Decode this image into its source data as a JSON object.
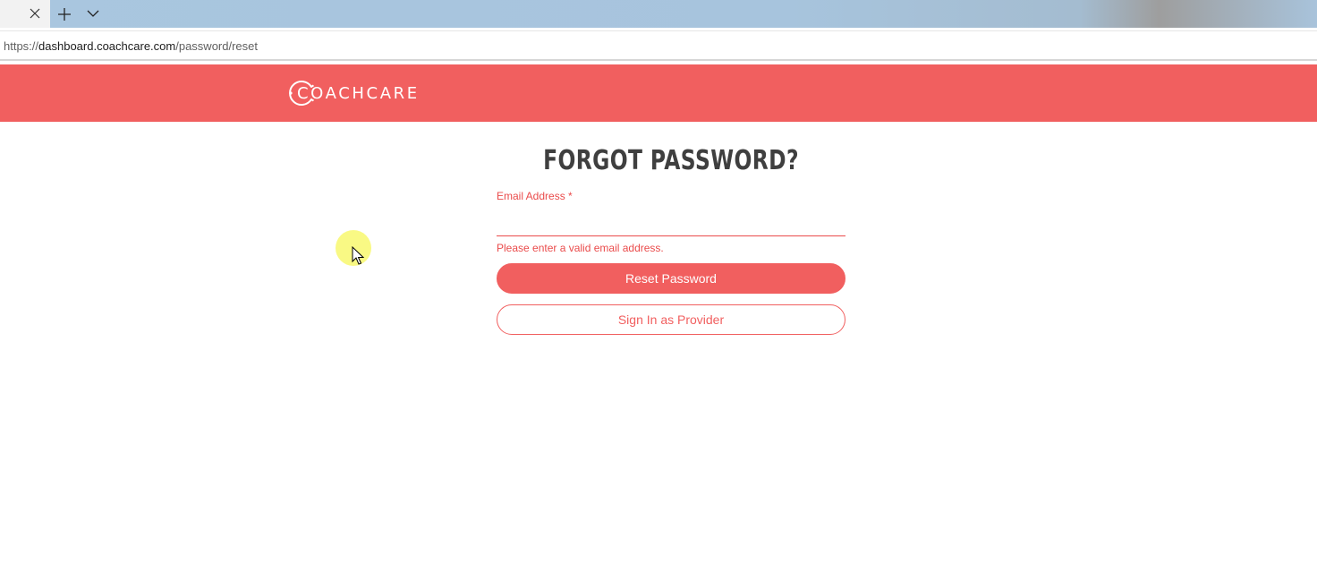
{
  "browser": {
    "url_scheme": "https://",
    "url_host": "dashboard.coachcare.com",
    "url_path": "/password/reset"
  },
  "header": {
    "brand": "COACHCARE",
    "background_color": "#f15f5f"
  },
  "form": {
    "title": "FORGOT PASSWORD?",
    "email_label": "Email Address *",
    "email_value": "",
    "error_message": "Please enter a valid email address.",
    "reset_button_label": "Reset Password",
    "provider_button_label": "Sign In as Provider"
  },
  "icons": {
    "tab_close": "close-icon",
    "new_tab": "plus-icon",
    "tab_list": "chevron-down-icon",
    "logo": "coachcare-circle-logo",
    "cursor": "mouse-pointer-icon"
  },
  "colors": {
    "accent": "#f15f5f",
    "error": "#ea4b4b",
    "title": "#3f3f3f"
  }
}
